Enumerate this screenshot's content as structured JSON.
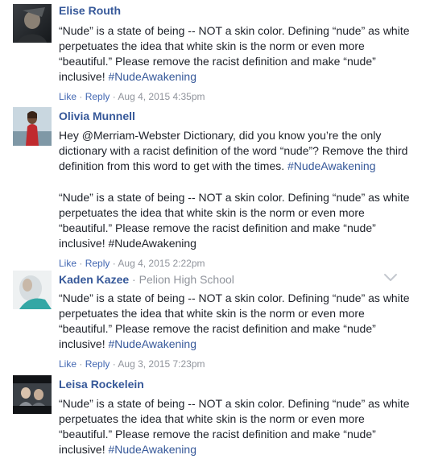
{
  "comments": [
    {
      "author": "Elise Routh",
      "affiliation": "",
      "paragraphs": [
        {
          "text": "“Nude” is a state of being -- NOT a skin color. Defining “nude” as white perpetuates the idea that white skin is the norm or even more “beautiful.” Please remove the racist definition and make “nude” inclusive!",
          "tag": "#NudeAwakening"
        }
      ],
      "like": "Like",
      "reply": "Reply",
      "timestamp": "Aug 4, 2015 4:35pm"
    },
    {
      "author": "Olivia Munnell",
      "affiliation": "",
      "paragraphs": [
        {
          "text": "Hey @Merriam-Webster Dictionary, did you know you’re the only dictionary with a racist definition of the word “nude”? Remove the third definition from this word to get with the times.",
          "tag": "#NudeAwakening"
        },
        {
          "text": "“Nude” is a state of being -- NOT a skin color. Defining “nude” as white perpetuates the idea that white skin is the norm or even more “beautiful.” Please remove the racist definition and make “nude” inclusive! #NudeAwakening",
          "tag": ""
        }
      ],
      "like": "Like",
      "reply": "Reply",
      "timestamp": "Aug 4, 2015 2:22pm"
    },
    {
      "author": "Kaden Kazee",
      "affiliation": "Pelion High School",
      "paragraphs": [
        {
          "text": "“Nude” is a state of being -- NOT a skin color. Defining “nude” as white perpetuates the idea that white skin is the norm or even more “beautiful.” Please remove the racist definition and make “nude” inclusive!",
          "tag": "#NudeAwakening"
        }
      ],
      "like": "Like",
      "reply": "Reply",
      "timestamp": "Aug 3, 2015 7:23pm"
    },
    {
      "author": "Leisa Rockelein",
      "affiliation": "",
      "paragraphs": [
        {
          "text": "“Nude” is a state of being -- NOT a skin color. Defining “nude” as white perpetuates the idea that white skin is the norm or even more “beautiful.” Please remove the racist definition and make “nude” inclusive!",
          "tag": "#NudeAwakening"
        }
      ],
      "like": "",
      "reply": "",
      "timestamp": ""
    }
  ],
  "separator": "·",
  "colors": {
    "author": "#365899",
    "link": "#4267b2",
    "muted": "#90949c",
    "text": "#1d2129"
  },
  "icons": {
    "options": "chevron-down-icon"
  }
}
